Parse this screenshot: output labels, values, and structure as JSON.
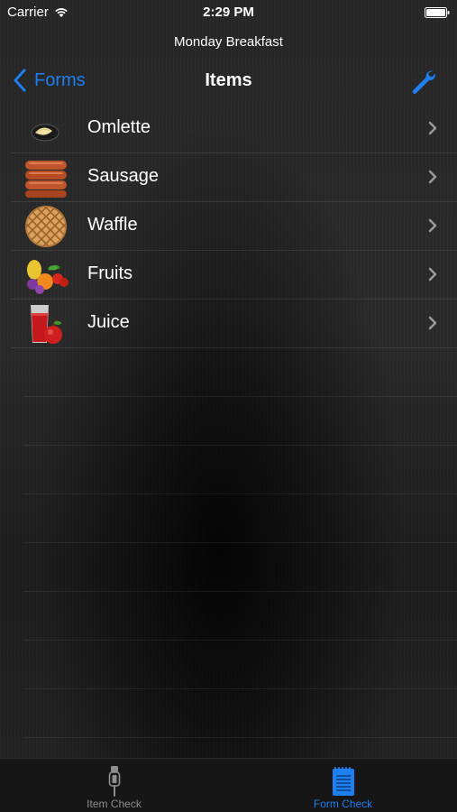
{
  "status_bar": {
    "carrier": "Carrier",
    "time": "2:29 PM"
  },
  "nav": {
    "subtitle": "Monday Breakfast",
    "back_label": "Forms",
    "title": "Items"
  },
  "items": [
    {
      "label": "Omlette",
      "icon": "omelette-pan-icon"
    },
    {
      "label": "Sausage",
      "icon": "sausage-icon"
    },
    {
      "label": "Waffle",
      "icon": "waffle-icon"
    },
    {
      "label": "Fruits",
      "icon": "fruits-icon"
    },
    {
      "label": "Juice",
      "icon": "juice-icon"
    }
  ],
  "tabs": [
    {
      "label": "Item Check",
      "icon": "thermometer-probe-icon",
      "selected": false
    },
    {
      "label": "Form Check",
      "icon": "notepad-icon",
      "selected": true
    }
  ],
  "colors": {
    "accent": "#1e7ff0",
    "inactive_tab": "#8e8e8e",
    "text": "#ffffff"
  }
}
